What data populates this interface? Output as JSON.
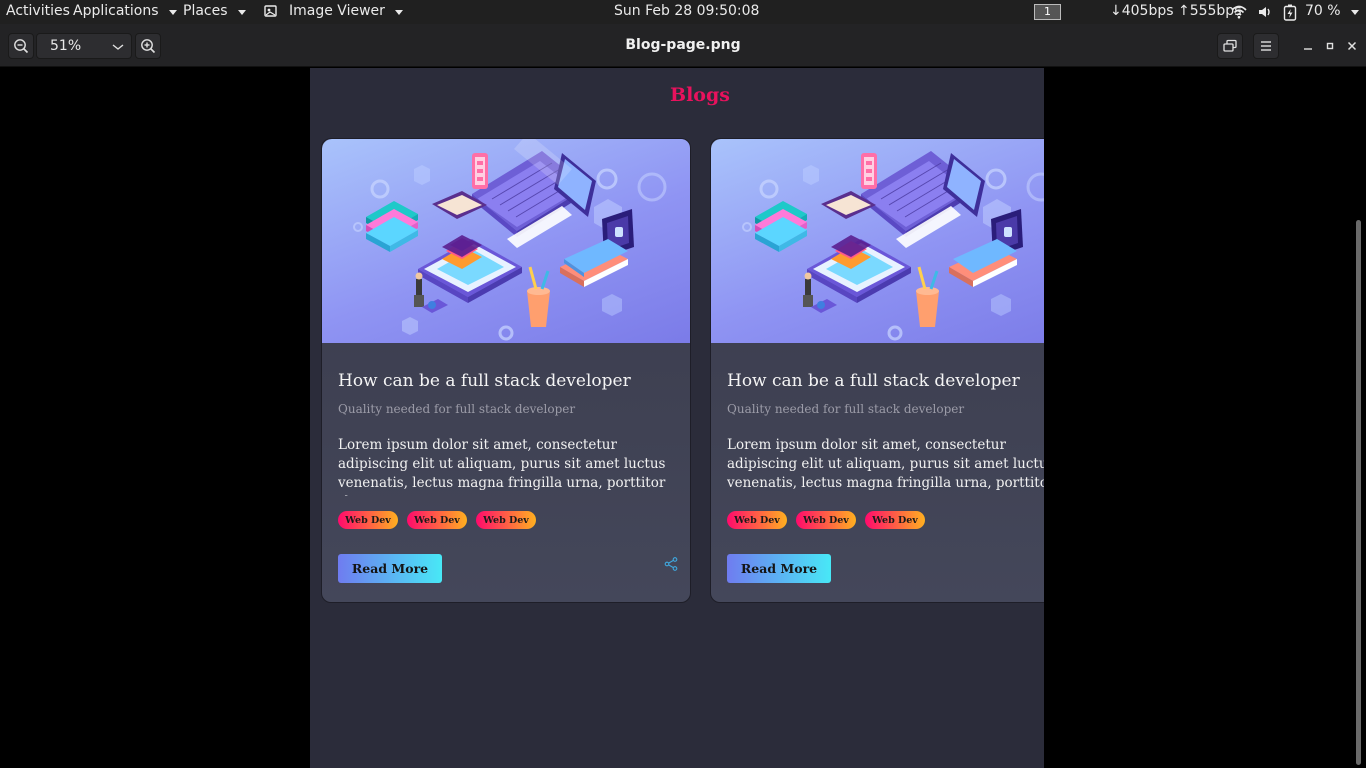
{
  "topbar": {
    "activities": "Activities",
    "applications": "Applications",
    "places": "Places",
    "app_menu": "Image Viewer",
    "clock": "Sun Feb 28  09:50:08",
    "workspace": "1",
    "network_speed": "↓405bps ↑555bps",
    "battery": "70 %"
  },
  "viewer": {
    "zoom": "51%",
    "title": "Blog-page.png"
  },
  "page": {
    "heading": "Blogs",
    "cards": [
      {
        "title": "How can be a full stack developer",
        "subtitle": "Quality needed for full stack developer",
        "body": "Lorem ipsum dolor sit amet, consectetur adipiscing elit ut aliquam, purus sit amet luctus venenatis, lectus magna fringilla urna, porttitor rh",
        "tags": [
          "Web Dev",
          "Web Dev",
          "Web Dev"
        ],
        "button": "Read More"
      },
      {
        "title": "How can be a full stack developer",
        "subtitle": "Quality needed for full stack developer",
        "body": "Lorem ipsum dolor sit amet, consectetur adipiscing elit ut aliquam, purus sit amet luctus venenatis, lectus magna fringilla urna, porttitor",
        "tags": [
          "Web Dev",
          "Web Dev",
          "Web Dev"
        ],
        "button": "Read More"
      }
    ]
  },
  "colors": {
    "heading": "#e8125d",
    "page_bg": "#2b2c3a",
    "tag_start": "#ff0a6c",
    "tag_end": "#ffb020",
    "button_start": "#6f7cf0",
    "button_end": "#48e8f6"
  },
  "icons": [
    "zoom-out-icon",
    "zoom-in-icon",
    "chevron-down-icon",
    "image-viewer-icon",
    "wifi-icon",
    "volume-icon",
    "battery-icon",
    "heart-icon",
    "share-icon",
    "minimize-icon",
    "maximize-icon",
    "close-icon",
    "slideshow-icon",
    "hamburger-menu-icon"
  ]
}
